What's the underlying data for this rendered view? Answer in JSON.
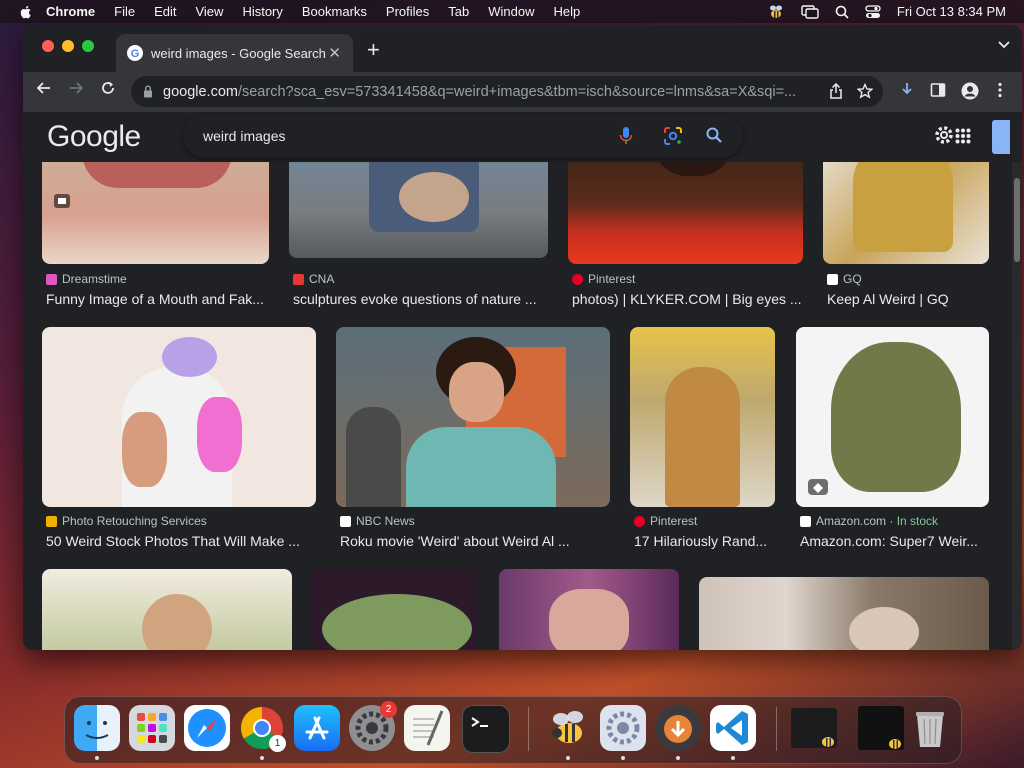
{
  "menubar": {
    "app": "Chrome",
    "items": [
      "File",
      "Edit",
      "View",
      "History",
      "Bookmarks",
      "Profiles",
      "Tab",
      "Window",
      "Help"
    ],
    "clock": "Fri Oct 13  8:34 PM"
  },
  "browser": {
    "tab_title": "weird images - Google Search",
    "url_domain": "google.com",
    "url_path": "/search?sca_esv=573341458&q=weird+images&tbm=isch&source=lnms&sa=X&sqi=..."
  },
  "search": {
    "logo": "Google",
    "query": "weird images"
  },
  "results": [
    {
      "source": "Dreamstime",
      "title": "Funny Image of a Mouth and Fak...",
      "fav": "#e056c0"
    },
    {
      "source": "CNA",
      "title": "sculptures evoke questions of nature ...",
      "fav": "#e53935"
    },
    {
      "source": "Pinterest",
      "title": "photos) | KLYKER.COM | Big eyes ...",
      "fav": "#e60023"
    },
    {
      "source": "GQ",
      "title": "Keep Al Weird | GQ",
      "fav": "#ffffff"
    },
    {
      "source": "Photo Retouching Services",
      "title": "50 Weird Stock Photos That Will Make ...",
      "fav": "#f0b400"
    },
    {
      "source": "NBC News",
      "title": "Roku movie 'Weird' about Weird Al ...",
      "fav": "#ffffff"
    },
    {
      "source": "Pinterest",
      "title": "17 Hilariously Rand...",
      "fav": "#e60023"
    },
    {
      "source": "Amazon.com",
      "extra": "In stock",
      "title": "Amazon.com: Super7 Weir...",
      "fav": "#ffffff"
    }
  ],
  "dock": {
    "badge_settings": "2",
    "badge_chrome": "1"
  },
  "colors": {
    "page_bg": "#202124",
    "toolbar": "#35363a",
    "accent": "#8ab4f8"
  }
}
